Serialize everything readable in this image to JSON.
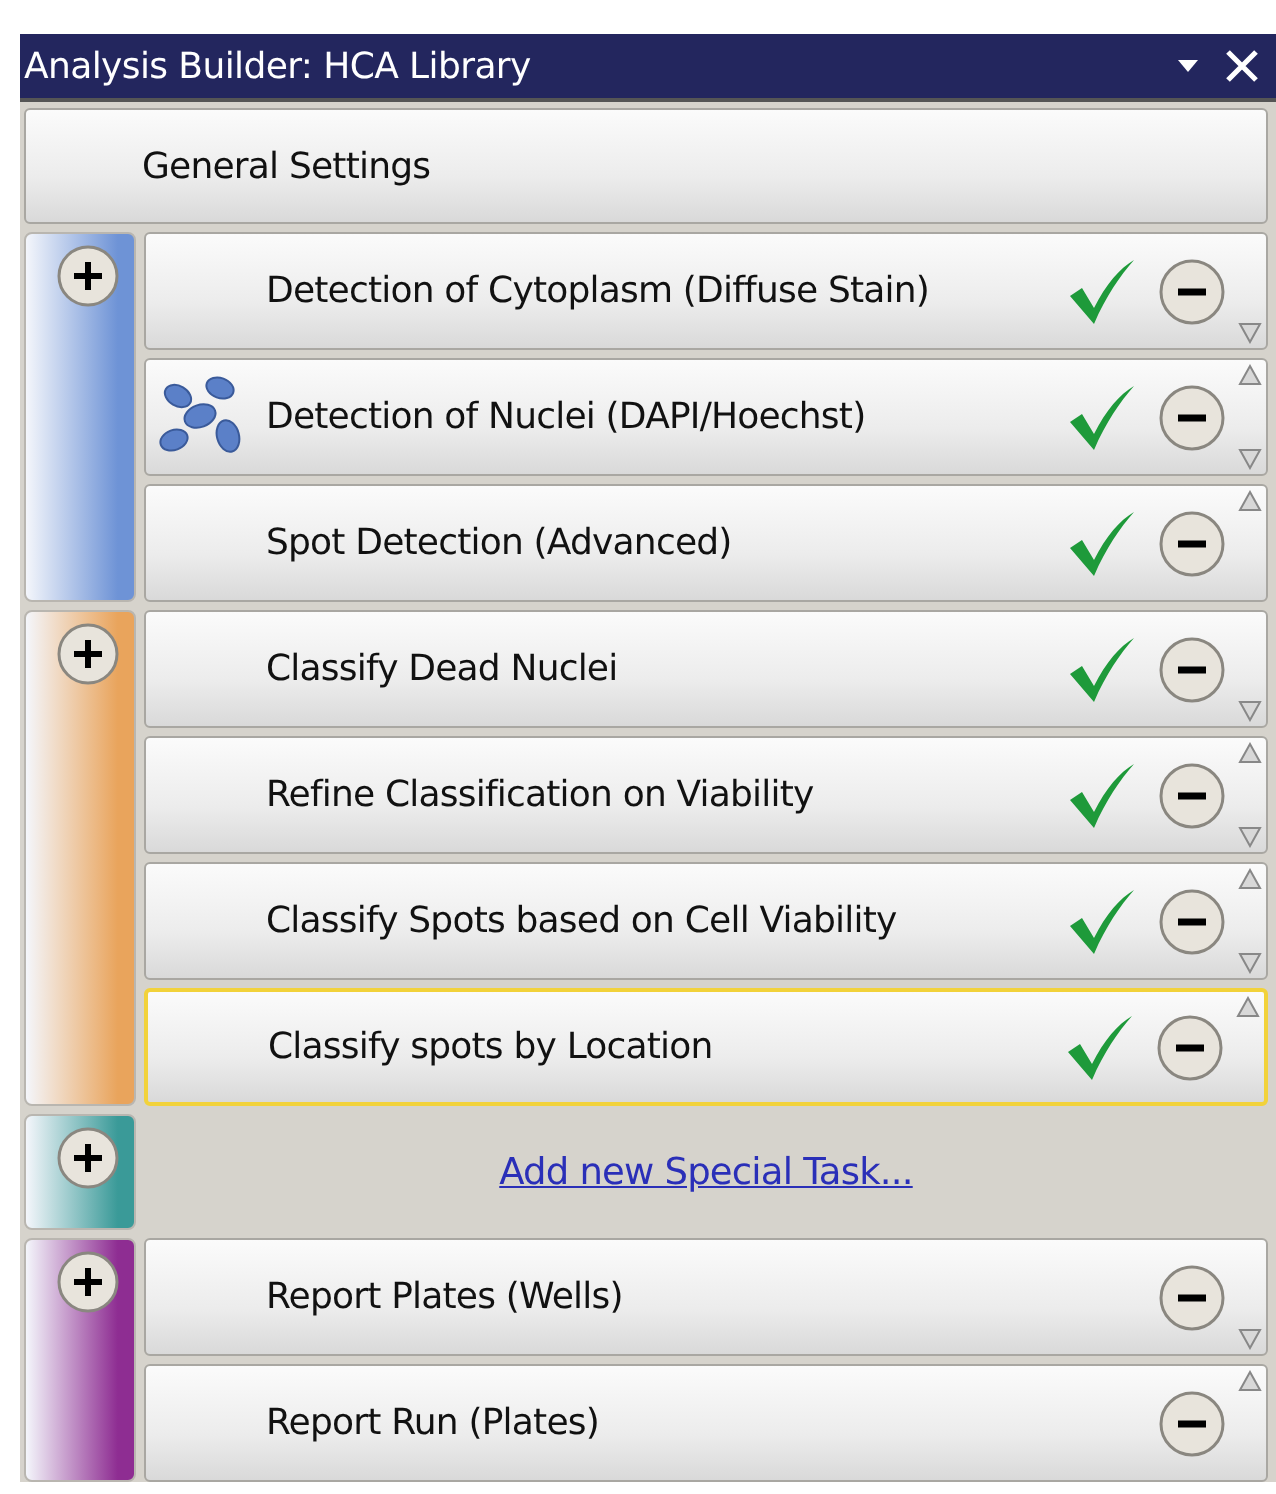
{
  "window": {
    "title": "Analysis Builder: HCA Library"
  },
  "general": {
    "label": "General Settings"
  },
  "groups": [
    {
      "kind": "tasks",
      "color": "#6e93d6",
      "tasks": [
        {
          "label": "Detection of Cytoplasm (Diffuse Stain)",
          "icon": false,
          "done": true,
          "selected": false,
          "move_up": false,
          "move_down": true
        },
        {
          "label": "Detection of Nuclei (DAPI/Hoechst)",
          "icon": true,
          "done": true,
          "selected": false,
          "move_up": true,
          "move_down": true
        },
        {
          "label": "Spot Detection (Advanced)",
          "icon": false,
          "done": true,
          "selected": false,
          "move_up": true,
          "move_down": false
        }
      ]
    },
    {
      "kind": "tasks",
      "color": "#e9a45c",
      "tasks": [
        {
          "label": "Classify Dead Nuclei",
          "icon": false,
          "done": true,
          "selected": false,
          "move_up": false,
          "move_down": true
        },
        {
          "label": "Refine Classification on Viability",
          "icon": false,
          "done": true,
          "selected": false,
          "move_up": true,
          "move_down": true
        },
        {
          "label": "Classify Spots based on Cell Viability",
          "icon": false,
          "done": true,
          "selected": false,
          "move_up": true,
          "move_down": true
        },
        {
          "label": "Classify spots by Location",
          "icon": false,
          "done": true,
          "selected": true,
          "move_up": true,
          "move_down": false
        }
      ]
    },
    {
      "kind": "link",
      "color": "#3a9a98",
      "link": "Add new Special Task..."
    },
    {
      "kind": "tasks",
      "color": "#8e2d92",
      "tasks": [
        {
          "label": "Report Plates (Wells)",
          "icon": false,
          "done": false,
          "selected": false,
          "move_up": false,
          "move_down": true
        },
        {
          "label": "Report Run (Plates)",
          "icon": false,
          "done": false,
          "selected": false,
          "move_up": true,
          "move_down": false
        }
      ]
    }
  ]
}
